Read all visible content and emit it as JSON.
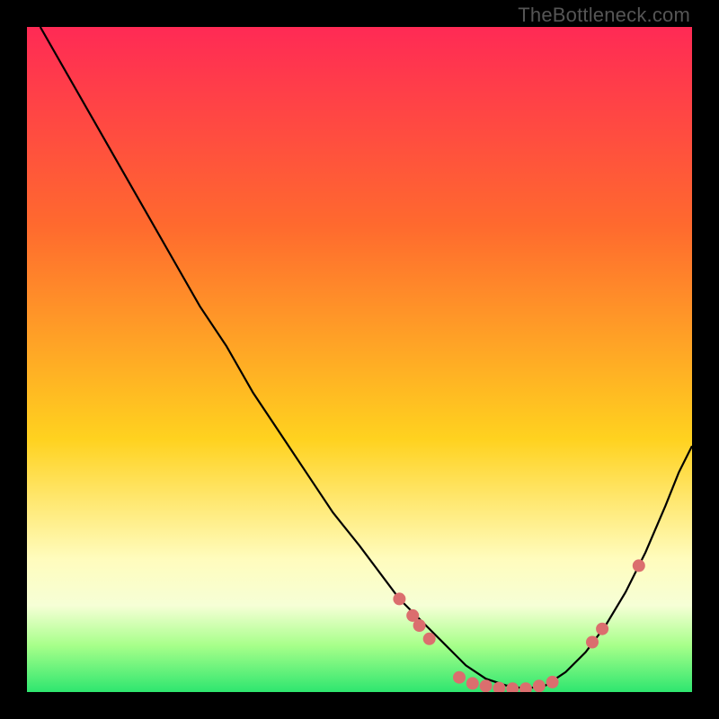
{
  "watermark": "TheBottleneck.com",
  "colors": {
    "bg": "#000000",
    "grad_top": "#ff2a55",
    "grad_mid1": "#ff6a2e",
    "grad_mid2": "#ffd21f",
    "grad_low": "#fffcbd",
    "grad_band": "#f6ffd6",
    "grad_bottom1": "#a7ff8a",
    "grad_bottom2": "#2ee66f",
    "curve": "#000000",
    "dot": "#db6e6e"
  },
  "chart_data": {
    "type": "line",
    "title": "",
    "xlabel": "",
    "ylabel": "",
    "xlim": [
      0,
      100
    ],
    "ylim": [
      0,
      100
    ],
    "x": [
      2,
      6,
      10,
      14,
      18,
      22,
      26,
      30,
      34,
      38,
      42,
      46,
      50,
      53,
      56,
      60,
      63,
      66,
      69,
      72,
      75,
      78,
      81,
      84,
      87,
      90,
      93,
      96,
      98,
      100
    ],
    "values": [
      100,
      93,
      86,
      79,
      72,
      65,
      58,
      52,
      45,
      39,
      33,
      27,
      22,
      18,
      14,
      10,
      7,
      4,
      2,
      1,
      0.5,
      1,
      3,
      6,
      10,
      15,
      21,
      28,
      33,
      37
    ],
    "series": [
      {
        "name": "bottleneck-curve",
        "x": [
          2,
          6,
          10,
          14,
          18,
          22,
          26,
          30,
          34,
          38,
          42,
          46,
          50,
          53,
          56,
          60,
          63,
          66,
          69,
          72,
          75,
          78,
          81,
          84,
          87,
          90,
          93,
          96,
          98,
          100
        ],
        "values": [
          100,
          93,
          86,
          79,
          72,
          65,
          58,
          52,
          45,
          39,
          33,
          27,
          22,
          18,
          14,
          10,
          7,
          4,
          2,
          1,
          0.5,
          1,
          3,
          6,
          10,
          15,
          21,
          28,
          33,
          37
        ]
      }
    ],
    "dots": [
      {
        "x": 56,
        "y": 14
      },
      {
        "x": 58,
        "y": 11.5
      },
      {
        "x": 59,
        "y": 10
      },
      {
        "x": 60.5,
        "y": 8
      },
      {
        "x": 65,
        "y": 2.2
      },
      {
        "x": 67,
        "y": 1.3
      },
      {
        "x": 69,
        "y": 0.9
      },
      {
        "x": 71,
        "y": 0.6
      },
      {
        "x": 73,
        "y": 0.5
      },
      {
        "x": 75,
        "y": 0.5
      },
      {
        "x": 77,
        "y": 0.9
      },
      {
        "x": 79,
        "y": 1.5
      },
      {
        "x": 85,
        "y": 7.5
      },
      {
        "x": 86.5,
        "y": 9.5
      },
      {
        "x": 92,
        "y": 19
      }
    ],
    "gradient_stops": [
      {
        "offset": 0.0,
        "color": "grad_top"
      },
      {
        "offset": 0.3,
        "color": "grad_mid1"
      },
      {
        "offset": 0.62,
        "color": "grad_mid2"
      },
      {
        "offset": 0.8,
        "color": "grad_low"
      },
      {
        "offset": 0.87,
        "color": "grad_band"
      },
      {
        "offset": 0.93,
        "color": "grad_bottom1"
      },
      {
        "offset": 1.0,
        "color": "grad_bottom2"
      }
    ]
  }
}
